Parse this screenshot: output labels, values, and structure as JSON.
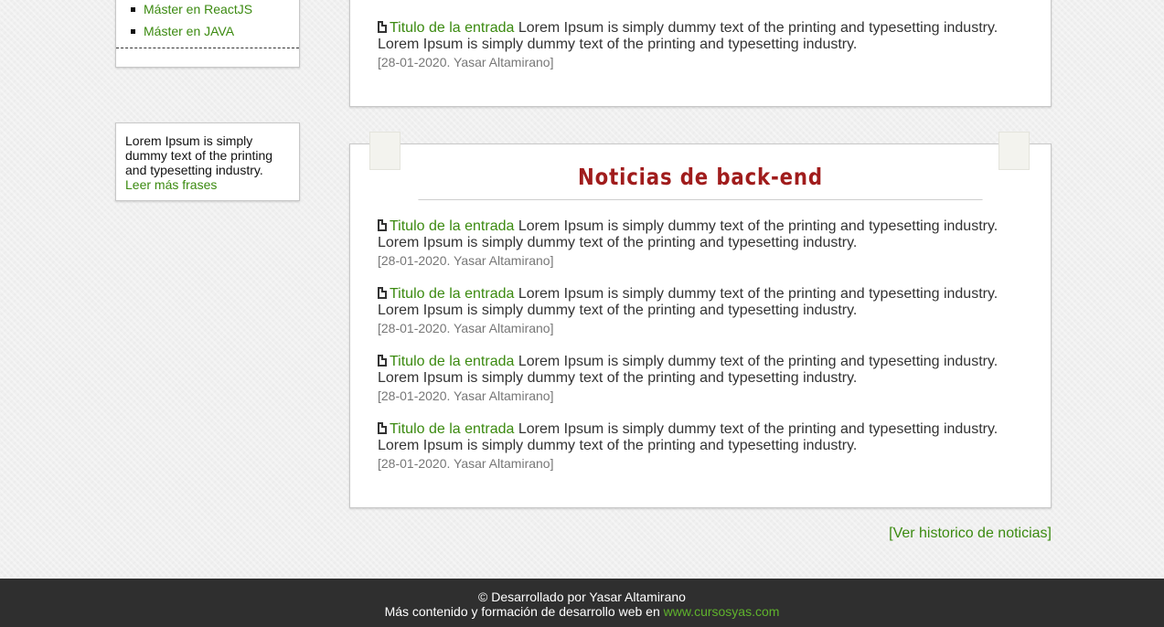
{
  "sidebar": {
    "menu_items": [
      "Máster en ReactJS",
      "Máster en JAVA"
    ],
    "quote": {
      "text": "Lorem Ipsum is simply dummy text of the printing and typesetting industry.",
      "more_link": "Leer más frases"
    }
  },
  "news_top": {
    "entries": [
      {
        "title": "Titulo de la entrada",
        "text": "Lorem Ipsum is simply dummy text of the printing and typesetting industry. Lorem Ipsum is simply dummy text of the printing and typesetting industry.",
        "meta": "[28-01-2020. Yasar Altamirano]"
      }
    ]
  },
  "news_backend": {
    "heading": "Noticias de back-end",
    "entries": [
      {
        "title": "Titulo de la entrada",
        "text": "Lorem Ipsum is simply dummy text of the printing and typesetting industry. Lorem Ipsum is simply dummy text of the printing and typesetting industry.",
        "meta": "[28-01-2020. Yasar Altamirano]"
      },
      {
        "title": "Titulo de la entrada",
        "text": "Lorem Ipsum is simply dummy text of the printing and typesetting industry. Lorem Ipsum is simply dummy text of the printing and typesetting industry.",
        "meta": "[28-01-2020. Yasar Altamirano]"
      },
      {
        "title": "Titulo de la entrada",
        "text": "Lorem Ipsum is simply dummy text of the printing and typesetting industry. Lorem Ipsum is simply dummy text of the printing and typesetting industry.",
        "meta": "[28-01-2020. Yasar Altamirano]"
      },
      {
        "title": "Titulo de la entrada",
        "text": "Lorem Ipsum is simply dummy text of the printing and typesetting industry. Lorem Ipsum is simply dummy text of the printing and typesetting industry.",
        "meta": "[28-01-2020. Yasar Altamirano]"
      }
    ]
  },
  "historic_link": "[Ver historico de noticias]",
  "footer": {
    "line1": "© Desarrollado por Yasar Altamirano",
    "line2": "Más contenido y formación de desarrollo web en",
    "link": "www.cursosyas.com"
  },
  "colors": {
    "link_green": "#3b8a10",
    "heading_red": "#a01c1c",
    "footer_bg": "#2f2f2f"
  },
  "icons": [
    "document-icon"
  ]
}
